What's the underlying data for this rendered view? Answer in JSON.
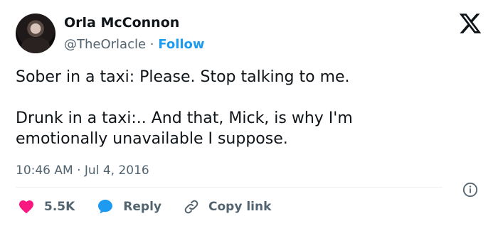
{
  "author": {
    "name": "Orla McConnon",
    "handle": "@TheOrlacle",
    "separator": "·",
    "follow_label": "Follow"
  },
  "tweet": {
    "text": "Sober in a taxi: Please. Stop talking to me.\n\nDrunk in a taxi:.. And that, Mick, is why I'm\nemotionally unavailable I suppose.",
    "time": "10:46 AM",
    "date_separator": "·",
    "date": "Jul 4, 2016"
  },
  "actions": {
    "likes_count": "5.5K",
    "reply_label": "Reply",
    "copy_link_label": "Copy link"
  },
  "icons": {
    "logo": "x-logo-icon",
    "like": "heart-icon",
    "reply": "speech-bubble-icon",
    "copy": "link-icon",
    "info": "info-icon"
  },
  "colors": {
    "text": "#0f1419",
    "muted": "#536471",
    "accent": "#1d9bf0",
    "heart": "#f91880"
  }
}
